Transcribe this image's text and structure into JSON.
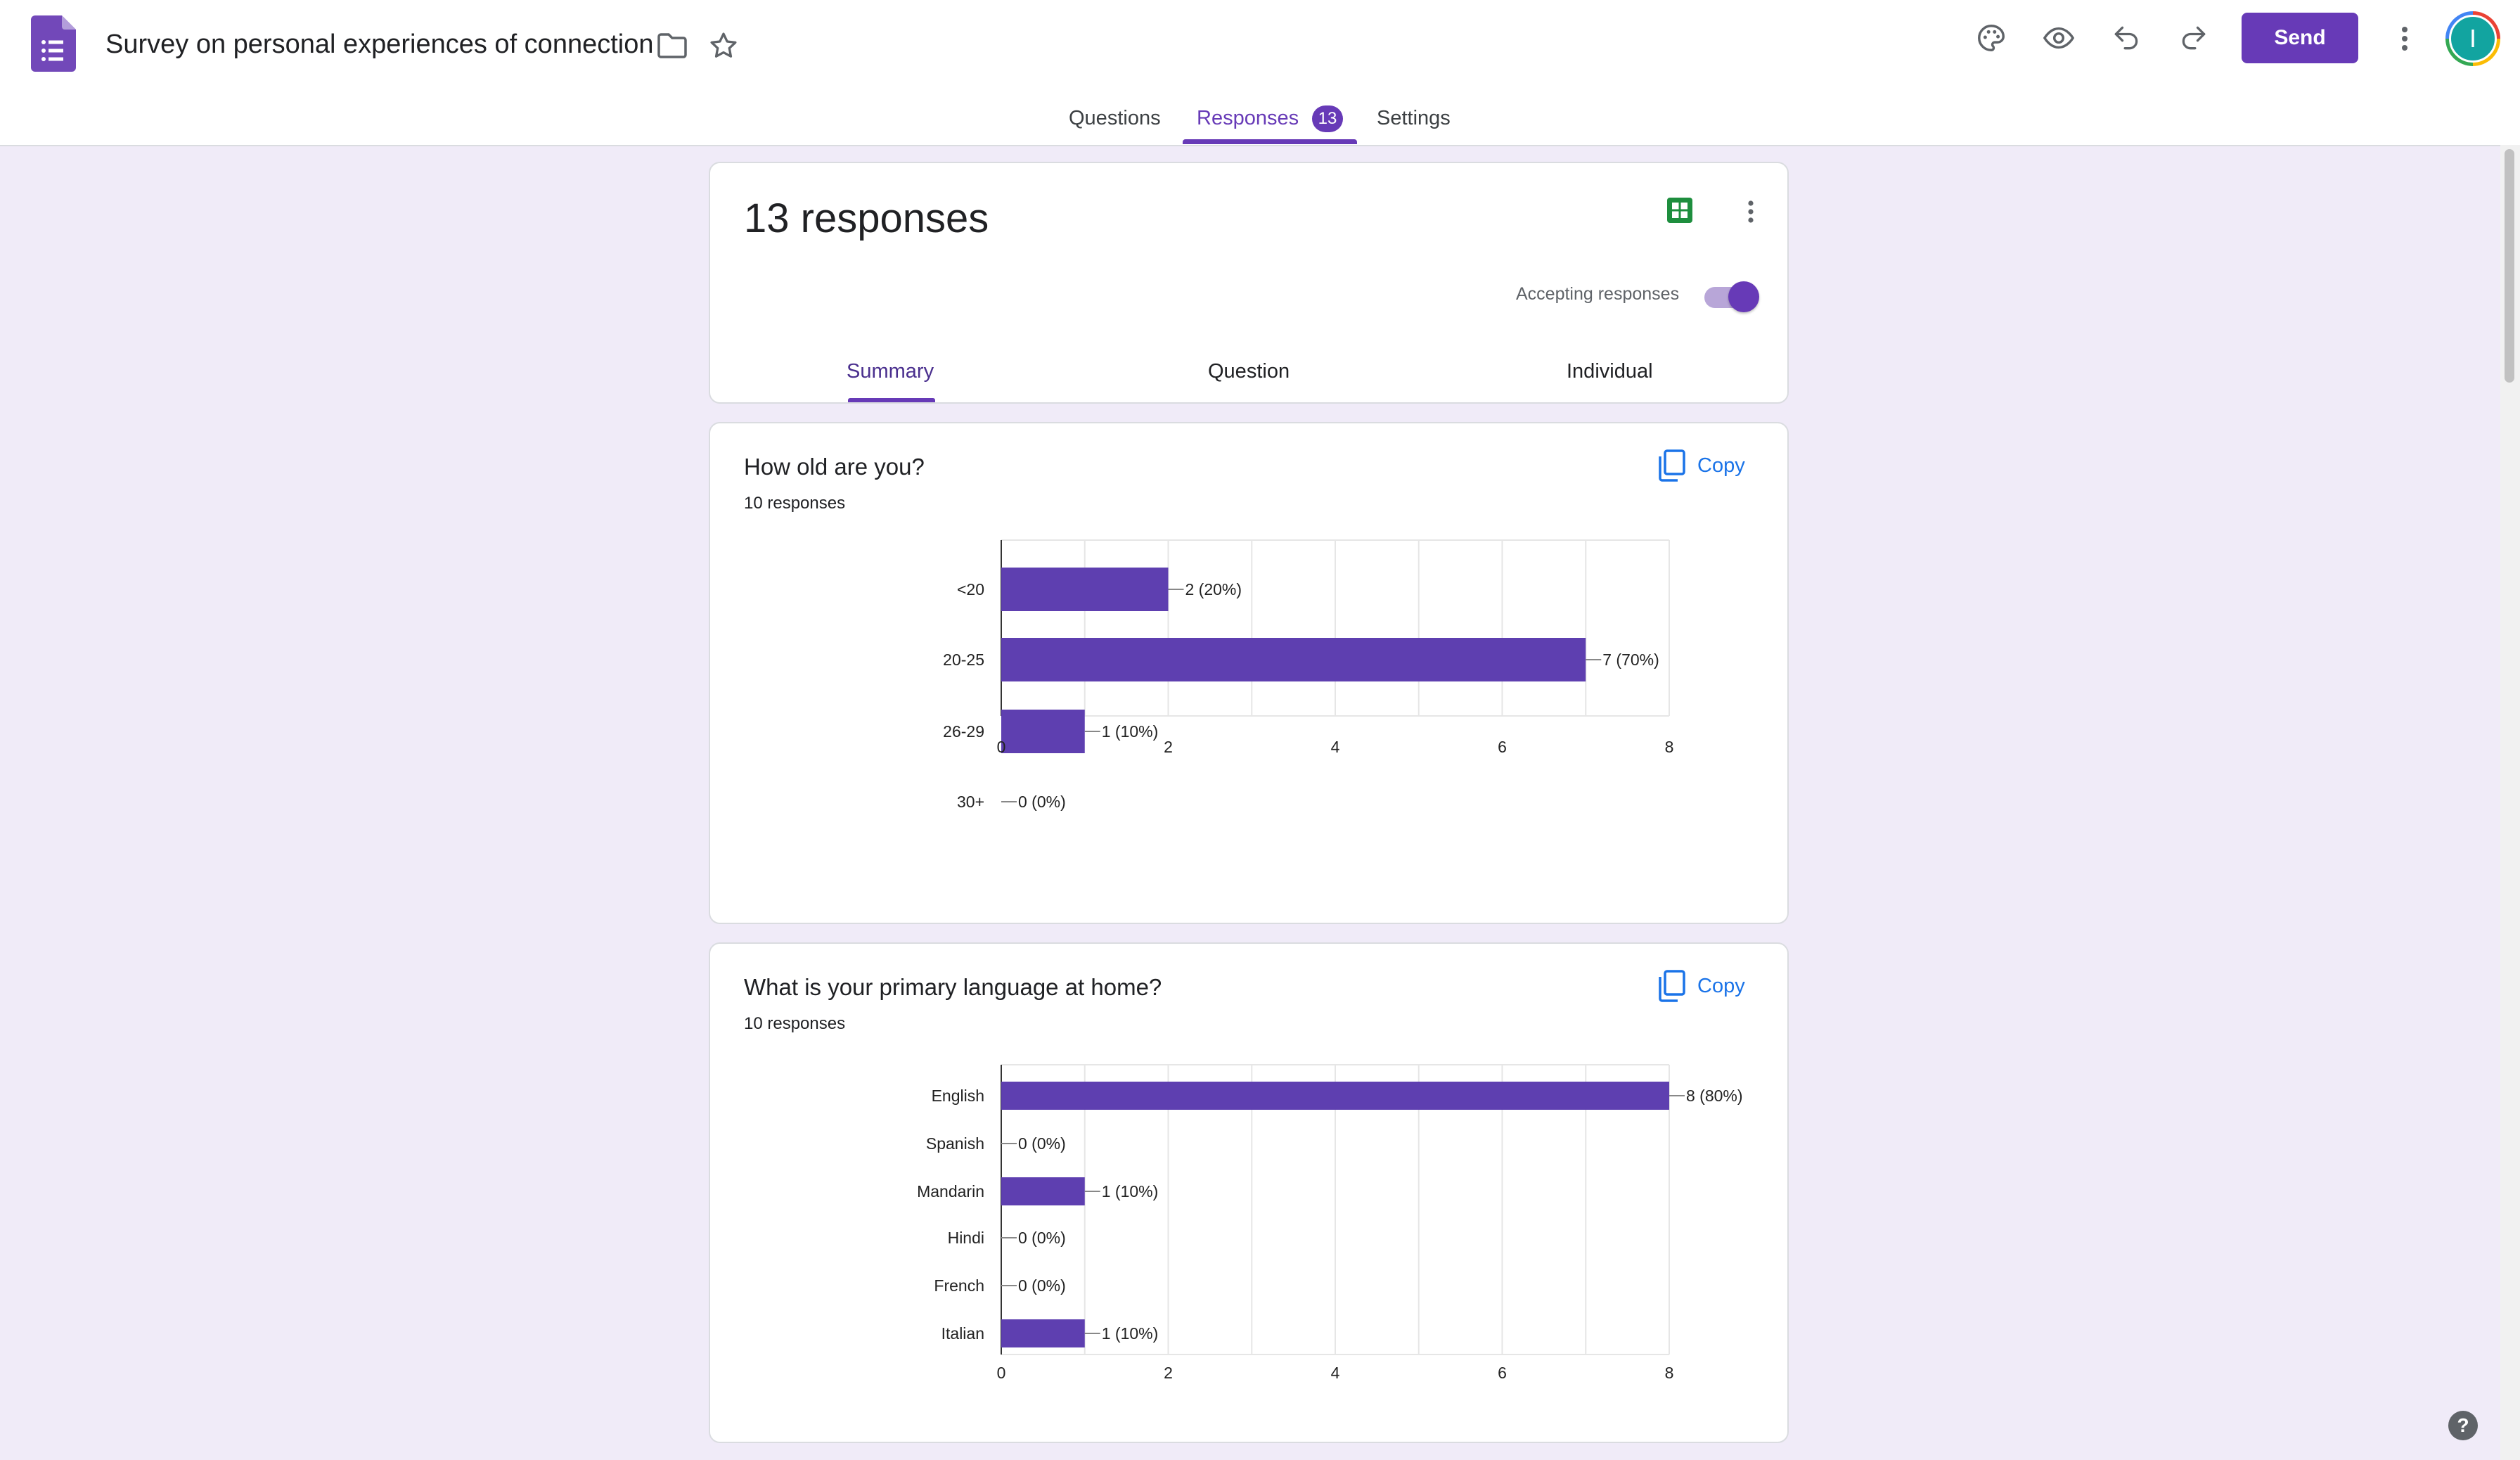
{
  "app": {
    "title": "Survey on personal experiences of connection",
    "icons": [
      "forms-logo-icon",
      "folder-icon",
      "star-icon",
      "palette-icon",
      "preview-eye-icon",
      "undo-icon",
      "redo-icon",
      "more-vert-icon"
    ],
    "send_label": "Send",
    "avatar_initial": "I",
    "accent_color": "#673ab7"
  },
  "tabs": [
    {
      "label": "Questions"
    },
    {
      "label": "Responses",
      "badge": "13",
      "active": true
    },
    {
      "label": "Settings"
    }
  ],
  "summary_card": {
    "title": "13 responses",
    "accepting_label": "Accepting responses",
    "accepting": true,
    "subtabs": [
      {
        "label": "Summary",
        "active": true
      },
      {
        "label": "Question"
      },
      {
        "label": "Individual"
      }
    ]
  },
  "questions": [
    {
      "title": "How old are you?",
      "count_text": "10 responses",
      "copy_label": "Copy"
    },
    {
      "title": "What is your primary language at home?",
      "count_text": "10 responses",
      "copy_label": "Copy"
    }
  ],
  "chart_data": [
    {
      "type": "bar",
      "orientation": "horizontal",
      "categories": [
        "<20",
        "20-25",
        "26-29",
        "30+"
      ],
      "values": [
        2,
        7,
        1,
        0
      ],
      "labels": [
        "2 (20%)",
        "7 (70%)",
        "1 (10%)",
        "0 (0%)"
      ],
      "xlim": [
        0,
        8
      ],
      "xticks": [
        "0",
        "2",
        "4",
        "6",
        "8"
      ],
      "grid": true,
      "color": "#5e3fb0"
    },
    {
      "type": "bar",
      "orientation": "horizontal",
      "categories": [
        "English",
        "Spanish",
        "Mandarin",
        "Hindi",
        "French",
        "Italian"
      ],
      "values": [
        8,
        0,
        1,
        0,
        0,
        1
      ],
      "labels": [
        "8 (80%)",
        "0 (0%)",
        "1 (10%)",
        "0 (0%)",
        "0 (0%)",
        "1 (10%)"
      ],
      "xlim": [
        0,
        8
      ],
      "xticks": [
        "0",
        "2",
        "4",
        "6",
        "8"
      ],
      "grid": true,
      "color": "#5e3fb0"
    }
  ],
  "help_label": "?"
}
